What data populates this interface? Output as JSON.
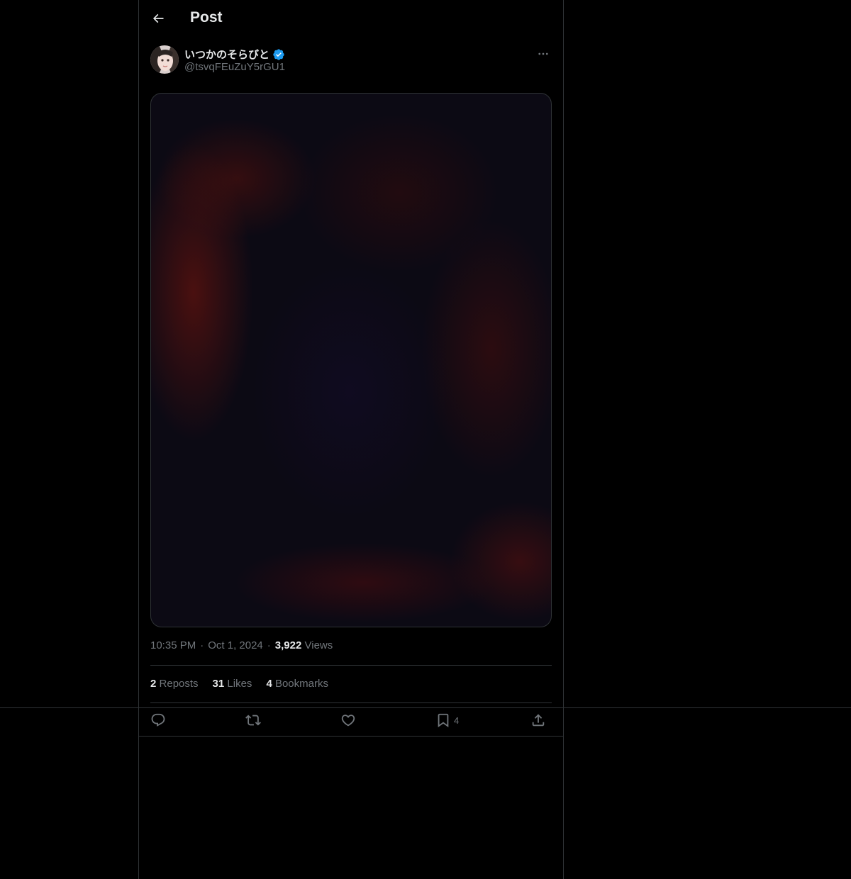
{
  "header": {
    "title": "Post"
  },
  "author": {
    "display_name": "いつかのそらびと",
    "handle": "@tsvqFEuZuY5rGU1",
    "verified": true
  },
  "meta": {
    "time": "10:35 PM",
    "date": "Oct 1, 2024",
    "views_count": "3,922",
    "views_label": "Views"
  },
  "stats": {
    "reposts_count": "2",
    "reposts_label": "Reposts",
    "likes_count": "31",
    "likes_label": "Likes",
    "bookmarks_count": "4",
    "bookmarks_label": "Bookmarks"
  },
  "actions": {
    "bookmark_count": "4"
  },
  "colors": {
    "background": "#000000",
    "text_primary": "#e7e9ea",
    "text_secondary": "#71767b",
    "border": "#2f3336",
    "verified_badge": "#1d9bf0"
  },
  "icons": [
    "back-arrow-icon",
    "verified-badge-icon",
    "more-icon",
    "reply-icon",
    "repost-icon",
    "like-icon",
    "bookmark-icon",
    "share-icon"
  ]
}
